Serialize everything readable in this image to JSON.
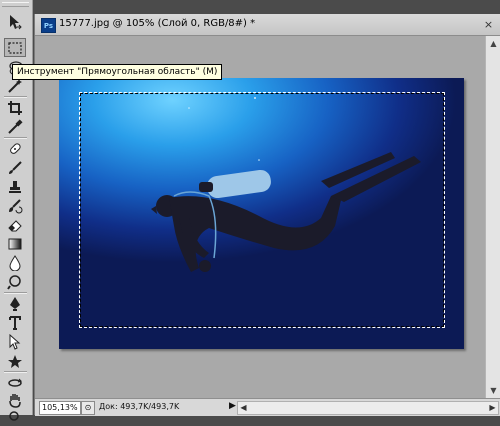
{
  "document": {
    "title": "15777.jpg @ 105% (Слой 0, RGB/8#) *",
    "app_icon_text": "Ps",
    "close_glyph": "×"
  },
  "tooltip": {
    "text": "Инструмент \"Прямоугольная область\" (M)"
  },
  "status": {
    "zoom": "105,13%",
    "doc_info": "Док: 493,7K/493,7K",
    "menu_arrow": "▶"
  },
  "tools": [
    {
      "name": "move-icon",
      "active": false
    },
    {
      "name": "rectangular-marquee-icon",
      "active": true
    },
    {
      "name": "lasso-icon",
      "active": false
    },
    {
      "name": "magic-wand-icon",
      "active": false
    },
    {
      "name": "crop-icon",
      "active": false
    },
    {
      "name": "eyedropper-icon",
      "active": false
    },
    {
      "name": "healing-brush-icon",
      "active": false
    },
    {
      "name": "brush-icon",
      "active": false
    },
    {
      "name": "clone-stamp-icon",
      "active": false
    },
    {
      "name": "history-brush-icon",
      "active": false
    },
    {
      "name": "eraser-icon",
      "active": false
    },
    {
      "name": "gradient-icon",
      "active": false
    },
    {
      "name": "blur-icon",
      "active": false
    },
    {
      "name": "dodge-icon",
      "active": false
    },
    {
      "name": "pen-icon",
      "active": false
    },
    {
      "name": "type-icon",
      "active": false
    },
    {
      "name": "path-selection-icon",
      "active": false
    },
    {
      "name": "shape-icon",
      "active": false
    },
    {
      "name": "3d-rotate-icon",
      "active": false
    },
    {
      "name": "3d-orbit-icon",
      "active": false
    },
    {
      "name": "hand-icon",
      "active": false
    },
    {
      "name": "zoom-icon",
      "active": false
    }
  ]
}
